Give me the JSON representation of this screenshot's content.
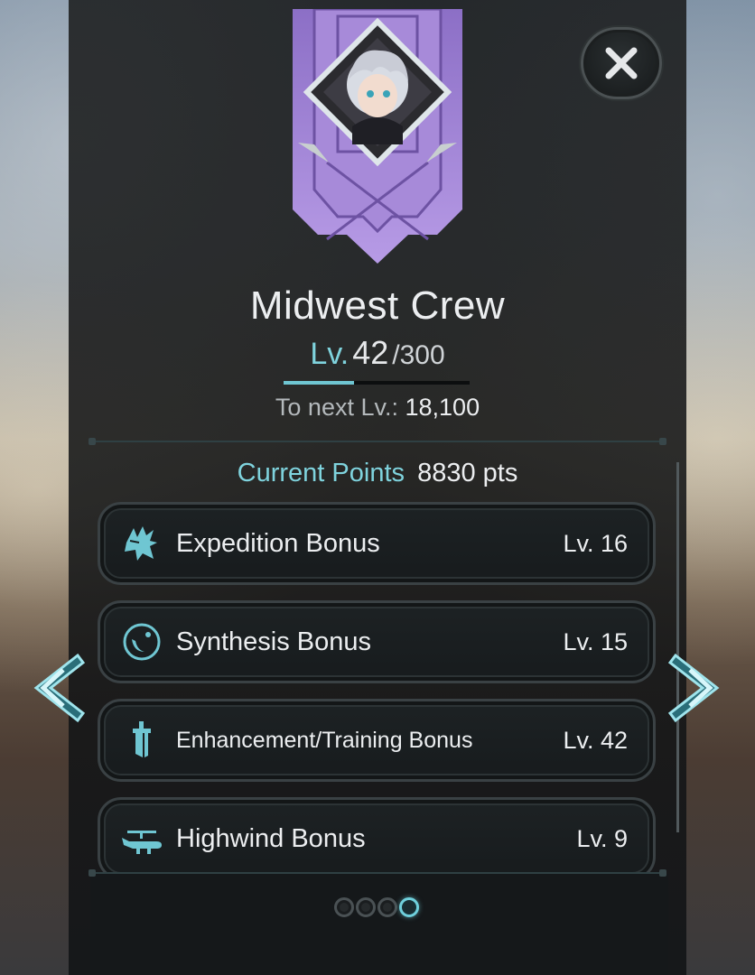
{
  "crew": {
    "name": "Midwest Crew",
    "level_label": "Lv.",
    "level": "42",
    "level_max": "/300",
    "xp_progress": 0.38,
    "to_next_label": "To next Lv.:",
    "to_next_value": "18,100"
  },
  "points": {
    "label": "Current Points",
    "value": "8830 pts"
  },
  "bonuses": [
    {
      "icon": "expedition-icon",
      "name": "Expedition Bonus",
      "level": "Lv. 16"
    },
    {
      "icon": "synthesis-icon",
      "name": "Synthesis Bonus",
      "level": "Lv. 15"
    },
    {
      "icon": "sword-icon",
      "name": "Enhancement/Training Bonus",
      "level": "Lv. 42"
    },
    {
      "icon": "airship-icon",
      "name": "Highwind Bonus",
      "level": "Lv. 9"
    }
  ],
  "pagination": {
    "total": 4,
    "current": 4
  },
  "colors": {
    "accent": "#7fd3dd",
    "banner": "#9b7fd0"
  }
}
